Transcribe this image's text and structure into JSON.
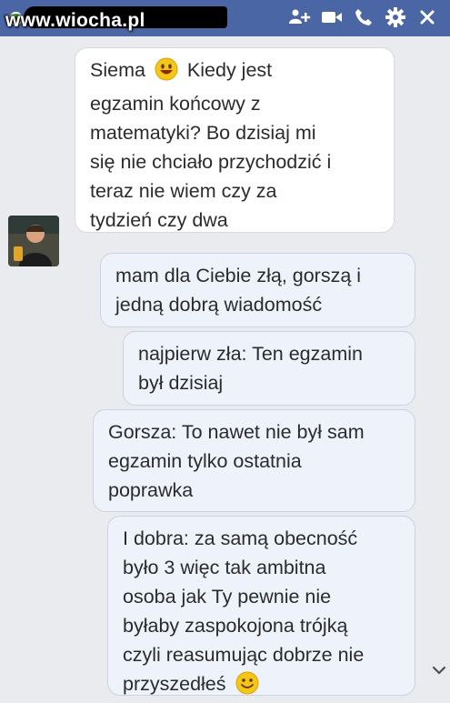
{
  "watermark": "www.wiocha.pl",
  "header": {
    "contact_name_redacted": true,
    "icons": [
      "add-person-icon",
      "video-call-icon",
      "phone-icon",
      "gear-icon",
      "close-icon"
    ]
  },
  "colors": {
    "header_bg": "#4a66a5",
    "chat_bg": "#e9ebee",
    "incoming_bubble": "#ffffff",
    "outgoing_bubble": "#eef3fb",
    "emoji": "#f5c518"
  },
  "messages": [
    {
      "direction": "incoming",
      "lines": [
        "Siema",
        "Kiedy jest",
        "egzamin końcowy z",
        "matematyki? Bo dzisiaj mi",
        "się nie chciało przychodzić i",
        "teraz nie wiem czy za",
        "tydzień czy dwa"
      ]
    },
    {
      "direction": "outgoing",
      "lines": [
        "mam dla Ciebie złą, gorszą i",
        "jedną dobrą wiadomość"
      ]
    },
    {
      "direction": "outgoing",
      "lines": [
        "najpierw zła: Ten egzamin",
        "był dzisiaj"
      ]
    },
    {
      "direction": "outgoing",
      "lines": [
        "Gorsza: To nawet nie był sam",
        "egzamin tylko ostatnia",
        "poprawka"
      ]
    },
    {
      "direction": "outgoing",
      "lines": [
        "I dobra: za samą obecność",
        "było 3 więc tak ambitna",
        "osoba jak Ty pewnie nie",
        "byłaby zaspokojona trójką",
        "czyli reasumując dobrze nie",
        "przyszedłeś"
      ]
    }
  ]
}
